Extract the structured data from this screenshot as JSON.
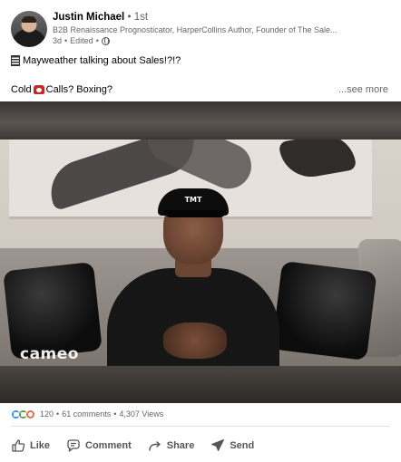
{
  "author": {
    "name": "Justin Michael",
    "degree_separator": "•",
    "degree": "1st",
    "headline": "B2B Renaissance Prognosticator, HarperCollins Author, Founder of The Sale...",
    "time": "3d",
    "edited": "Edited",
    "visibility_icon": "globe-icon"
  },
  "post": {
    "line1": "Mayweather talking about Sales!?!?",
    "line1_icon": "book-icon",
    "line2_before": "Cold",
    "line2_icon": "telephone-icon",
    "line2_after": "Calls? Boxing?",
    "see_more": "...see more"
  },
  "video": {
    "watermark": "cameo",
    "cap_text": "TMT"
  },
  "social": {
    "reactions": [
      "like-reaction-icon",
      "support-reaction-icon",
      "love-reaction-icon"
    ],
    "reaction_count": "120",
    "comments": "61 comments",
    "views": "4,307 Views",
    "separator": "•"
  },
  "actions": {
    "like": "Like",
    "comment": "Comment",
    "share": "Share",
    "send": "Send"
  },
  "colors": {
    "link_gray": "#666666",
    "action_gray": "#555555",
    "like_blue": "#378fe9",
    "support_green": "#5f9b41",
    "love_orange": "#df704d"
  }
}
